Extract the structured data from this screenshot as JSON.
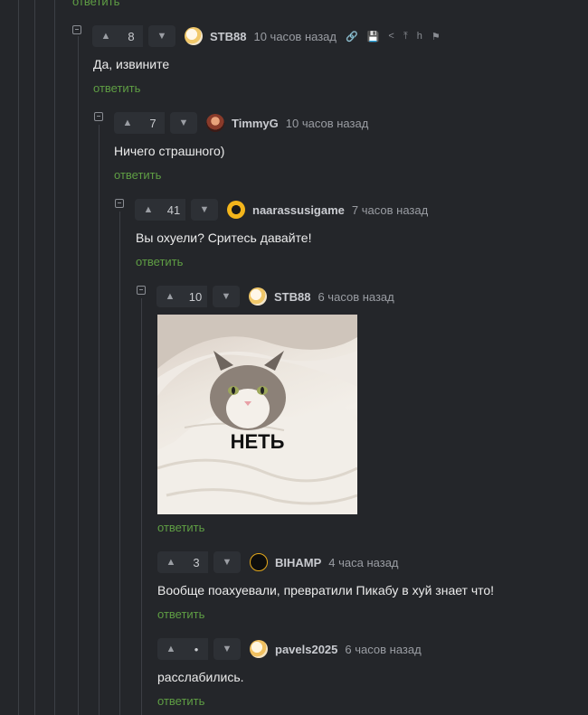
{
  "top_reply_label": "ответить",
  "comments": [
    {
      "rating": "8",
      "author": "STB88",
      "time": "10 часов назад",
      "text": "Да, извините",
      "reply": "ответить"
    },
    {
      "rating": "7",
      "author": "TimmyG",
      "time": "10 часов назад",
      "text": "Ничего страшного)",
      "reply": "ответить"
    },
    {
      "rating": "41",
      "author": "naarassusigame",
      "time": "7 часов назад",
      "text": "Вы охуели? Сритесь давайте!",
      "reply": "ответить"
    },
    {
      "rating": "10",
      "author": "STB88",
      "time": "6 часов назад",
      "image_caption": "НЕТЬ",
      "reply": "ответить"
    },
    {
      "rating": "3",
      "author": "BIHAMP",
      "time": "4 часа назад",
      "text": "Вообще поахуевали, превратили Пикабу в хуй знает что!",
      "reply": "ответить"
    },
    {
      "rating": "•",
      "author": "pavels2025",
      "time": "6 часов назад",
      "text": "расслабились.",
      "reply": "ответить"
    }
  ],
  "icons": {
    "up": "▲",
    "down": "▼",
    "link": "🔗",
    "save": "💾",
    "share": "<",
    "up_to_parent": "⤒",
    "branch": "h",
    "flag": "⚑"
  },
  "colors": {
    "background": "#24262a",
    "link_green": "#5f9e44"
  }
}
